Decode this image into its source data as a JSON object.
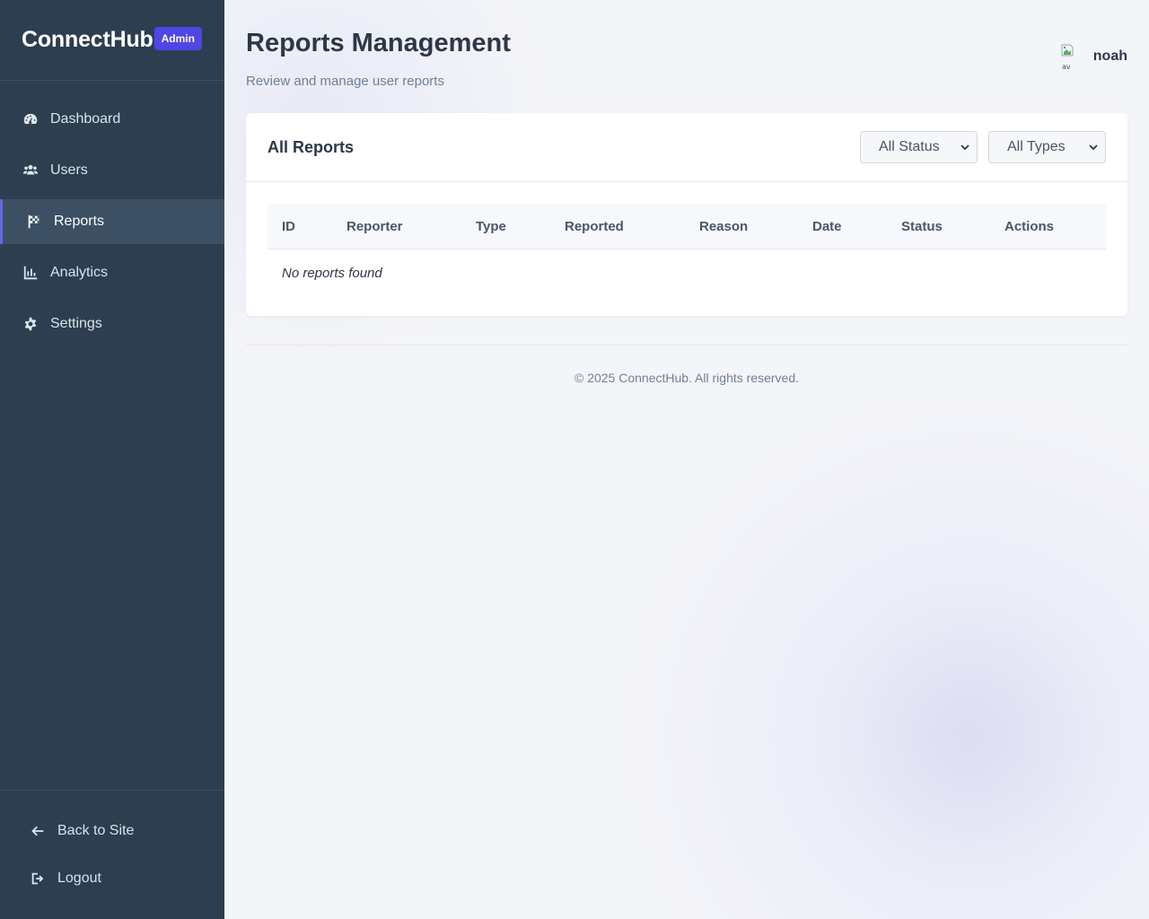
{
  "sidebar": {
    "brand": "ConnectHub",
    "badge": "Admin",
    "items": [
      {
        "label": "Dashboard",
        "icon": "dashboard-icon"
      },
      {
        "label": "Users",
        "icon": "users-icon"
      },
      {
        "label": "Reports",
        "icon": "flag-icon",
        "active": true
      },
      {
        "label": "Analytics",
        "icon": "chart-icon"
      },
      {
        "label": "Settings",
        "icon": "gear-icon"
      }
    ],
    "bottom": [
      {
        "label": "Back to Site",
        "icon": "arrow-left-icon"
      },
      {
        "label": "Logout",
        "icon": "logout-icon"
      }
    ]
  },
  "header": {
    "title": "Reports Management",
    "subtitle": "Review and manage user reports",
    "user": "noah"
  },
  "card": {
    "title": "All Reports",
    "filters": {
      "status": "All Status",
      "type": "All Types"
    },
    "columns": [
      "ID",
      "Reporter",
      "Type",
      "Reported",
      "Reason",
      "Date",
      "Status",
      "Actions"
    ],
    "empty_message": "No reports found"
  },
  "footer": {
    "text": "© 2025 ConnectHub. All rights reserved."
  },
  "colors": {
    "sidebar_bg": "#2c3e50",
    "accent": "#4f46e5",
    "page_bg": "#f4f5f9"
  }
}
